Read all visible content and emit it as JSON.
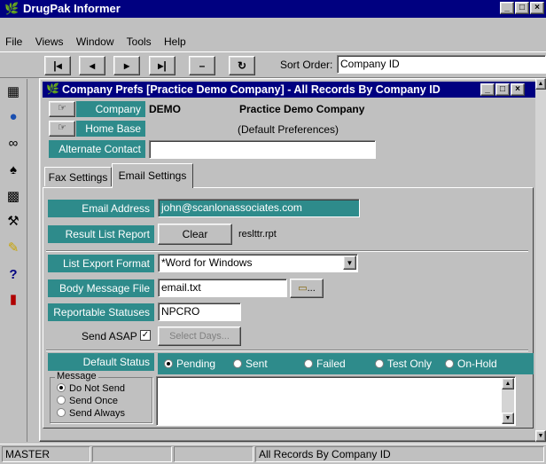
{
  "app": {
    "title": "DrugPak Informer"
  },
  "menu": [
    "File",
    "Views",
    "Window",
    "Tools",
    "Help"
  ],
  "toolbar": {
    "buttons": [
      "|◂",
      "◂",
      "▸",
      "▸|",
      "–",
      "↻"
    ],
    "sort_label": "Sort Order:",
    "sort_value": "Company ID"
  },
  "child": {
    "title": "Company Prefs [Practice Demo Company] - All Records By Company ID",
    "company_label": "Company",
    "company_code": "DEMO",
    "company_name": "Practice Demo Company",
    "home_base_label": "Home Base",
    "home_base_value": "(Default Preferences)",
    "alt_contact_label": "Alternate Contact",
    "alt_contact_value": ""
  },
  "tabs": [
    "Fax Settings",
    "Email Settings"
  ],
  "email": {
    "address_label": "Email Address",
    "address_value": "john@scanlonassociates.com",
    "result_label": "Result List Report",
    "clear_label": "Clear",
    "result_file": "reslttr.rpt",
    "export_label": "List Export Format",
    "export_value": "*Word for Windows",
    "body_label": "Body Message File",
    "body_value": "email.txt",
    "browse_label": "...",
    "statuses_label": "Reportable Statuses",
    "statuses_value": "NPCRO",
    "send_asap_label": "Send ASAP",
    "select_days_label": "Select Days...",
    "default_status_label": "Default Status",
    "status_options": [
      "Pending",
      "Sent",
      "Failed",
      "Test Only",
      "On-Hold"
    ],
    "message_group": "Message",
    "message_options": [
      "Do Not Send",
      "Send Once",
      "Send Always"
    ]
  },
  "statusbar": {
    "mode": "MASTER",
    "sort": "All Records By Company ID"
  }
}
